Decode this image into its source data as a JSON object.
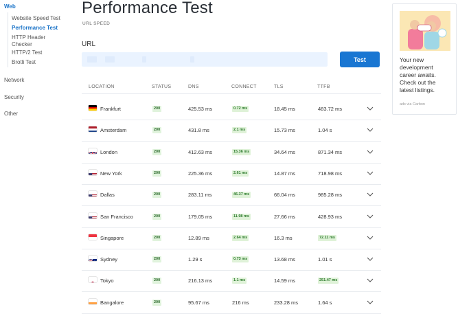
{
  "sidebar": {
    "categories": {
      "web": "Web",
      "network": "Network",
      "security": "Security",
      "other": "Other"
    },
    "web_items": [
      {
        "label": "Website Speed Test"
      },
      {
        "label": "Performance Test"
      },
      {
        "label": "HTTP Header Checker"
      },
      {
        "label": "HTTP/2 Test"
      },
      {
        "label": "Brotli Test"
      }
    ]
  },
  "header": {
    "title": "Performance Test",
    "subtitle": "URL SPEED"
  },
  "form": {
    "url_label": "URL",
    "url_value": "",
    "test_button": "Test"
  },
  "table": {
    "columns": [
      "LOCATION",
      "STATUS",
      "DNS",
      "CONNECT",
      "TLS",
      "TTFB"
    ],
    "rows": [
      {
        "location": "Frankfurt",
        "flag": "germany-flag",
        "status": "200",
        "dns": "425.53 ms",
        "connect": "0.72 ms",
        "tls": "18.45 ms",
        "ttfb": "483.72 ms"
      },
      {
        "location": "Amsterdam",
        "flag": "netherlands-flag",
        "status": "200",
        "dns": "431.8 ms",
        "connect": "2.1 ms",
        "tls": "15.73 ms",
        "ttfb": "1.04 s"
      },
      {
        "location": "London",
        "flag": "uk-flag",
        "status": "200",
        "dns": "412.63 ms",
        "connect": "15.36 ms",
        "tls": "34.64 ms",
        "ttfb": "871.34 ms"
      },
      {
        "location": "New York",
        "flag": "us-flag",
        "status": "200",
        "dns": "225.36 ms",
        "connect": "2.61 ms",
        "tls": "14.87 ms",
        "ttfb": "718.98 ms"
      },
      {
        "location": "Dallas",
        "flag": "us-flag",
        "status": "200",
        "dns": "283.11 ms",
        "connect": "46.37 ms",
        "tls": "66.04 ms",
        "ttfb": "985.28 ms"
      },
      {
        "location": "San Francisco",
        "flag": "us-flag",
        "status": "200",
        "dns": "179.05 ms",
        "connect": "11.98 ms",
        "tls": "27.66 ms",
        "ttfb": "428.93 ms"
      },
      {
        "location": "Singapore",
        "flag": "singapore-flag",
        "status": "200",
        "dns": "12.89 ms",
        "connect": "2.64 ms",
        "tls": "16.3 ms",
        "ttfb": "72.11 ms"
      },
      {
        "location": "Sydney",
        "flag": "australia-flag",
        "status": "200",
        "dns": "1.29 s",
        "connect": "0.73 ms",
        "tls": "13.68 ms",
        "ttfb": "1.01 s"
      },
      {
        "location": "Tokyo",
        "flag": "japan-flag",
        "status": "200",
        "dns": "216.13 ms",
        "connect": "1.1 ms",
        "tls": "14.59 ms",
        "ttfb": "251.47 ms"
      },
      {
        "location": "Bangalore",
        "flag": "india-flag",
        "status": "200",
        "dns": "95.67 ms",
        "connect": "216 ms",
        "tls": "233.28 ms",
        "ttfb": "1.64 s"
      }
    ]
  },
  "ad": {
    "text": "Your new development career awaits. Check out the latest listings.",
    "via": "ads via Carbon"
  },
  "colors": {
    "accent": "#1976d2",
    "active_link": "#1a73c8",
    "badge_bg": "#e0f3dc",
    "input_bg": "#eaf3ff"
  }
}
